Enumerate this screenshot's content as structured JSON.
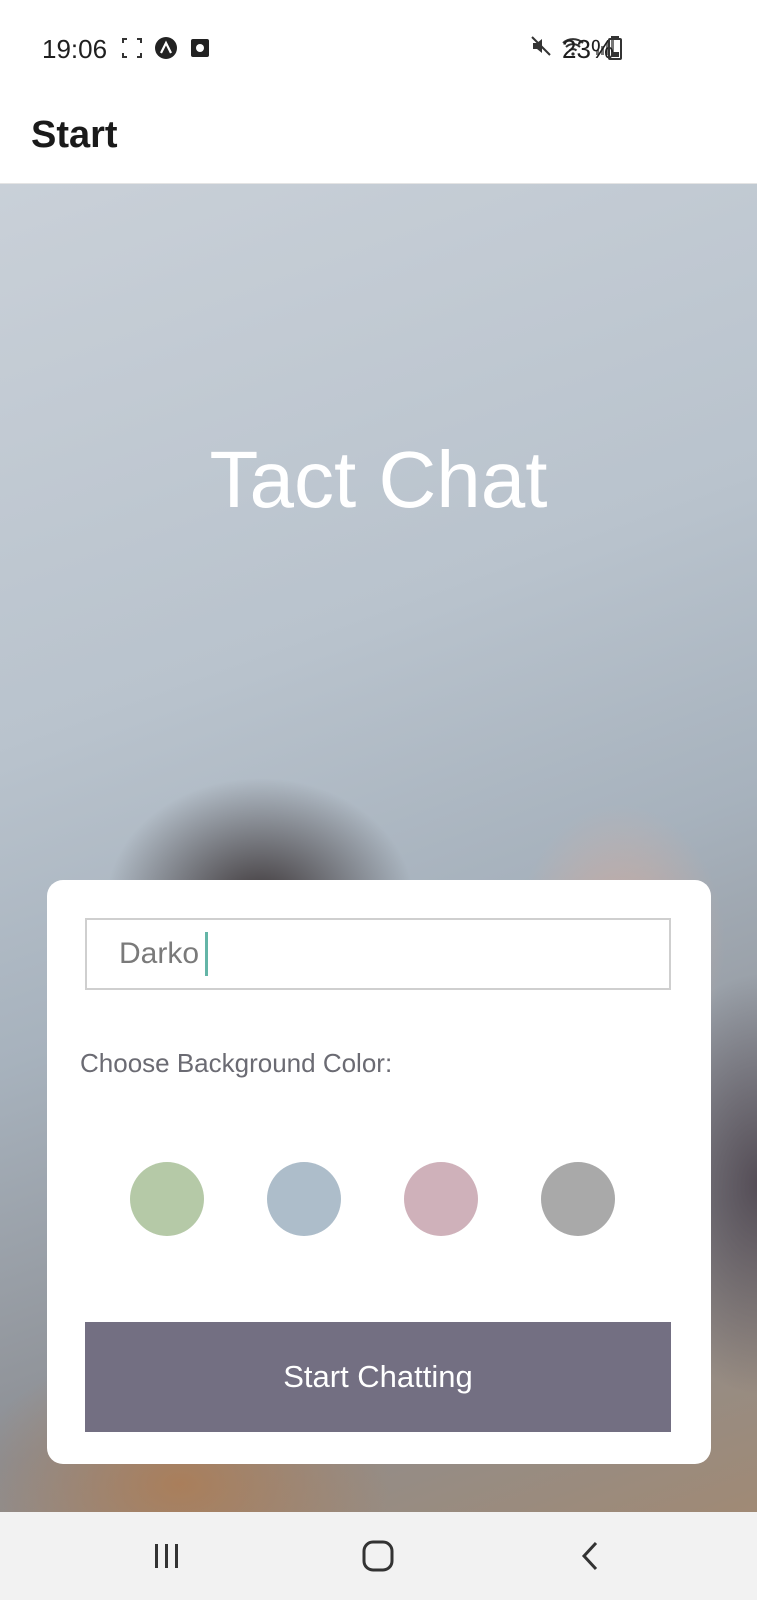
{
  "status_bar": {
    "time": "19:06",
    "battery": "23%",
    "icons": [
      "screenshot-icon",
      "a-badge-icon",
      "gallery-icon",
      "mute-icon",
      "wifi-icon",
      "signal-icon",
      "battery-icon"
    ]
  },
  "app_bar": {
    "title": "Start"
  },
  "hero": {
    "title": "Tact Chat"
  },
  "form": {
    "name_value": "Darko",
    "choose_label": "Choose Background Color:",
    "colors": [
      "#b5c9a7",
      "#adbdca",
      "#cfb1ba",
      "#a9a9a9"
    ],
    "start_label": "Start Chatting"
  },
  "nav_bar": {
    "icons": [
      "recent-apps-icon",
      "home-icon",
      "back-icon"
    ]
  }
}
